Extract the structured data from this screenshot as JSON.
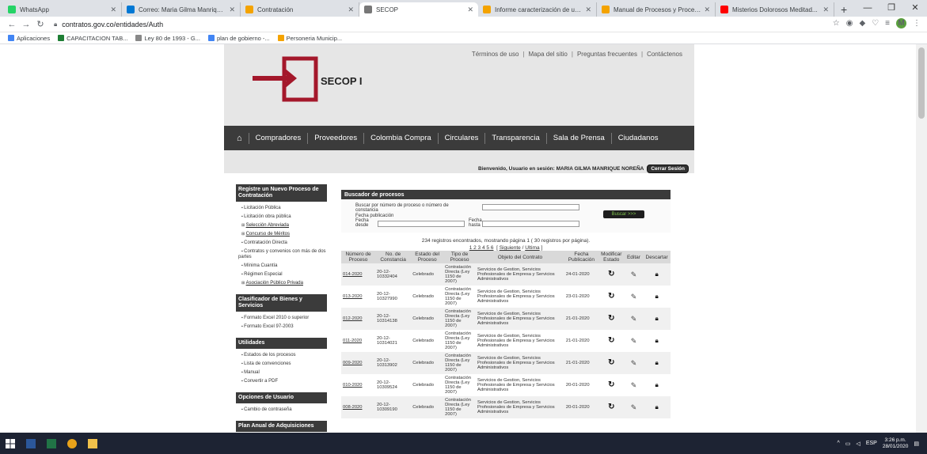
{
  "browser": {
    "tabs": [
      {
        "title": "WhatsApp",
        "color": "#25d366",
        "active": false
      },
      {
        "title": "Correo: Maria Gilma Manrique M...",
        "color": "#0078d4",
        "active": false
      },
      {
        "title": "Contratación",
        "color": "#f4a300",
        "active": false
      },
      {
        "title": "SECOP",
        "color": "#777777",
        "active": true
      },
      {
        "title": "Informe caracterización de usua...",
        "color": "#f4a300",
        "active": false
      },
      {
        "title": "Manual de Procesos y Procedim...",
        "color": "#f4a300",
        "active": false
      },
      {
        "title": "Misterios Dolorosos Meditad...",
        "color": "#ff0000",
        "active": false
      }
    ],
    "url": "contratos.gov.co/entidades/Auth",
    "bookmarks": [
      {
        "label": "Aplicaciones",
        "color": "#4285f4"
      },
      {
        "label": "CAPACITACION TAB...",
        "color": "#1e7e34"
      },
      {
        "label": "Ley 80 de 1993 - G...",
        "color": "#888888"
      },
      {
        "label": "plan de gobierno -...",
        "color": "#4285f4"
      },
      {
        "label": "Personeria Municip...",
        "color": "#f4a300"
      }
    ],
    "profile_initial": "M"
  },
  "site": {
    "top_links": [
      "Términos de uso",
      "Mapa del sitio",
      "Preguntas frecuentes",
      "Contáctenos"
    ],
    "logo_text": "SECOP I",
    "brand_color": "#a4182b",
    "nav": [
      "Compradores",
      "Proveedores",
      "Colombia Compra",
      "Circulares",
      "Transparencia",
      "Sala de Prensa",
      "Ciudadanos"
    ],
    "welcome": "Bienvenido, Usuario en sesión: MARIA GILMA MANRIQUE NOREÑA",
    "logout": "Cerrar Sesión"
  },
  "sidebar": {
    "sec1_title": "Registre un Nuevo Proceso de Contratación",
    "sec1_items": [
      {
        "label": "Licitación Pública",
        "type": "bullet"
      },
      {
        "label": "Licitación obra pública",
        "type": "bullet"
      },
      {
        "label": "Selección Abreviada",
        "type": "plus"
      },
      {
        "label": "Concurso de Méritos",
        "type": "plus"
      },
      {
        "label": "Contratación Directa",
        "type": "bullet"
      },
      {
        "label": "Contratos y convenios con más de dos partes",
        "type": "bullet"
      },
      {
        "label": "Mínima Cuantía",
        "type": "bullet"
      },
      {
        "label": "Régimen Especial",
        "type": "bullet"
      },
      {
        "label": "Asociación Público Privada",
        "type": "plus"
      }
    ],
    "sec2_title": "Clasificador de Bienes y Servicios",
    "sec2_items": [
      "Formato Excel 2010 o superior",
      "Formato Excel 97-2003"
    ],
    "sec3_title": "Utilidades",
    "sec3_items": [
      "Estados de los procesos",
      "Lista de convenciones",
      "Manual",
      "Convertir a PDF"
    ],
    "sec4_title": "Opciones de Usuario",
    "sec4_items": [
      "Cambio de contraseña"
    ],
    "sec5_title": "Plan Anual de Adquisiciones"
  },
  "search": {
    "title": "Buscador de procesos",
    "label_number": "Buscar por número de proceso o número de constancia",
    "label_date": "Fecha publicación",
    "label_from": "Fecha desde",
    "label_to": "Fecha hasta",
    "button": "Buscar >>>"
  },
  "results": {
    "info": "234 registros encontrados, mostrando página 1 ( 30 registros por página).",
    "pages": "1 2 3 4 5 6",
    "next": "Siguiente",
    "last": "Ultima",
    "columns": [
      "Número de Proceso",
      "No. de Constancia",
      "Estado del Proceso",
      "Tipo de Proceso",
      "Objeto del Contrato",
      "Fecha Publicación",
      "Modificar Estado",
      "Editar",
      "Descartar"
    ],
    "rows": [
      {
        "num": "014-2020",
        "const": "20-12-10332404",
        "estado": "Celebrado",
        "tipo": "Contratación Directa (Ley 1150 de 2007)",
        "objeto": "Servicios de Gestion, Servicios Profesionales de Empresa y Servicios Administrativos",
        "fecha": "24-01-2020"
      },
      {
        "num": "013-2020",
        "const": "20-12-10327990",
        "estado": "Celebrado",
        "tipo": "Contratación Directa (Ley 1150 de 2007)",
        "objeto": "Servicios de Gestion, Servicios Profesionales de Empresa y Servicios Administrativos",
        "fecha": "23-01-2020"
      },
      {
        "num": "012-2020",
        "const": "20-12-10314138",
        "estado": "Celebrado",
        "tipo": "Contratación Directa (Ley 1150 de 2007)",
        "objeto": "Servicios de Gestion, Servicios Profesionales de Empresa y Servicios Administrativos",
        "fecha": "21-01-2020"
      },
      {
        "num": "011-2020",
        "const": "20-12-10314021",
        "estado": "Celebrado",
        "tipo": "Contratación Directa (Ley 1150 de 2007)",
        "objeto": "Servicios de Gestion, Servicios Profesionales de Empresa y Servicios Administrativos",
        "fecha": "21-01-2020"
      },
      {
        "num": "009-2020",
        "const": "20-12-10313902",
        "estado": "Celebrado",
        "tipo": "Contratación Directa (Ley 1150 de 2007)",
        "objeto": "Servicios de Gestion, Servicios Profesionales de Empresa y Servicios Administrativos",
        "fecha": "21-01-2020"
      },
      {
        "num": "010-2020",
        "const": "20-12-10309524",
        "estado": "Celebrado",
        "tipo": "Contratación Directa (Ley 1150 de 2007)",
        "objeto": "Servicios de Gestion, Servicios Profesionales de Empresa y Servicios Administrativos",
        "fecha": "20-01-2020"
      },
      {
        "num": "008-2020",
        "const": "20-12-10309190",
        "estado": "Celebrado",
        "tipo": "Contratación Directa (Ley 1150 de 2007)",
        "objeto": "Servicios de Gestion, Servicios Profesionales de Empresa y Servicios Administrativos",
        "fecha": "20-01-2020"
      }
    ]
  },
  "taskbar": {
    "lang": "ESP",
    "time": "3:26 p.m.",
    "date": "28/01/2020"
  }
}
